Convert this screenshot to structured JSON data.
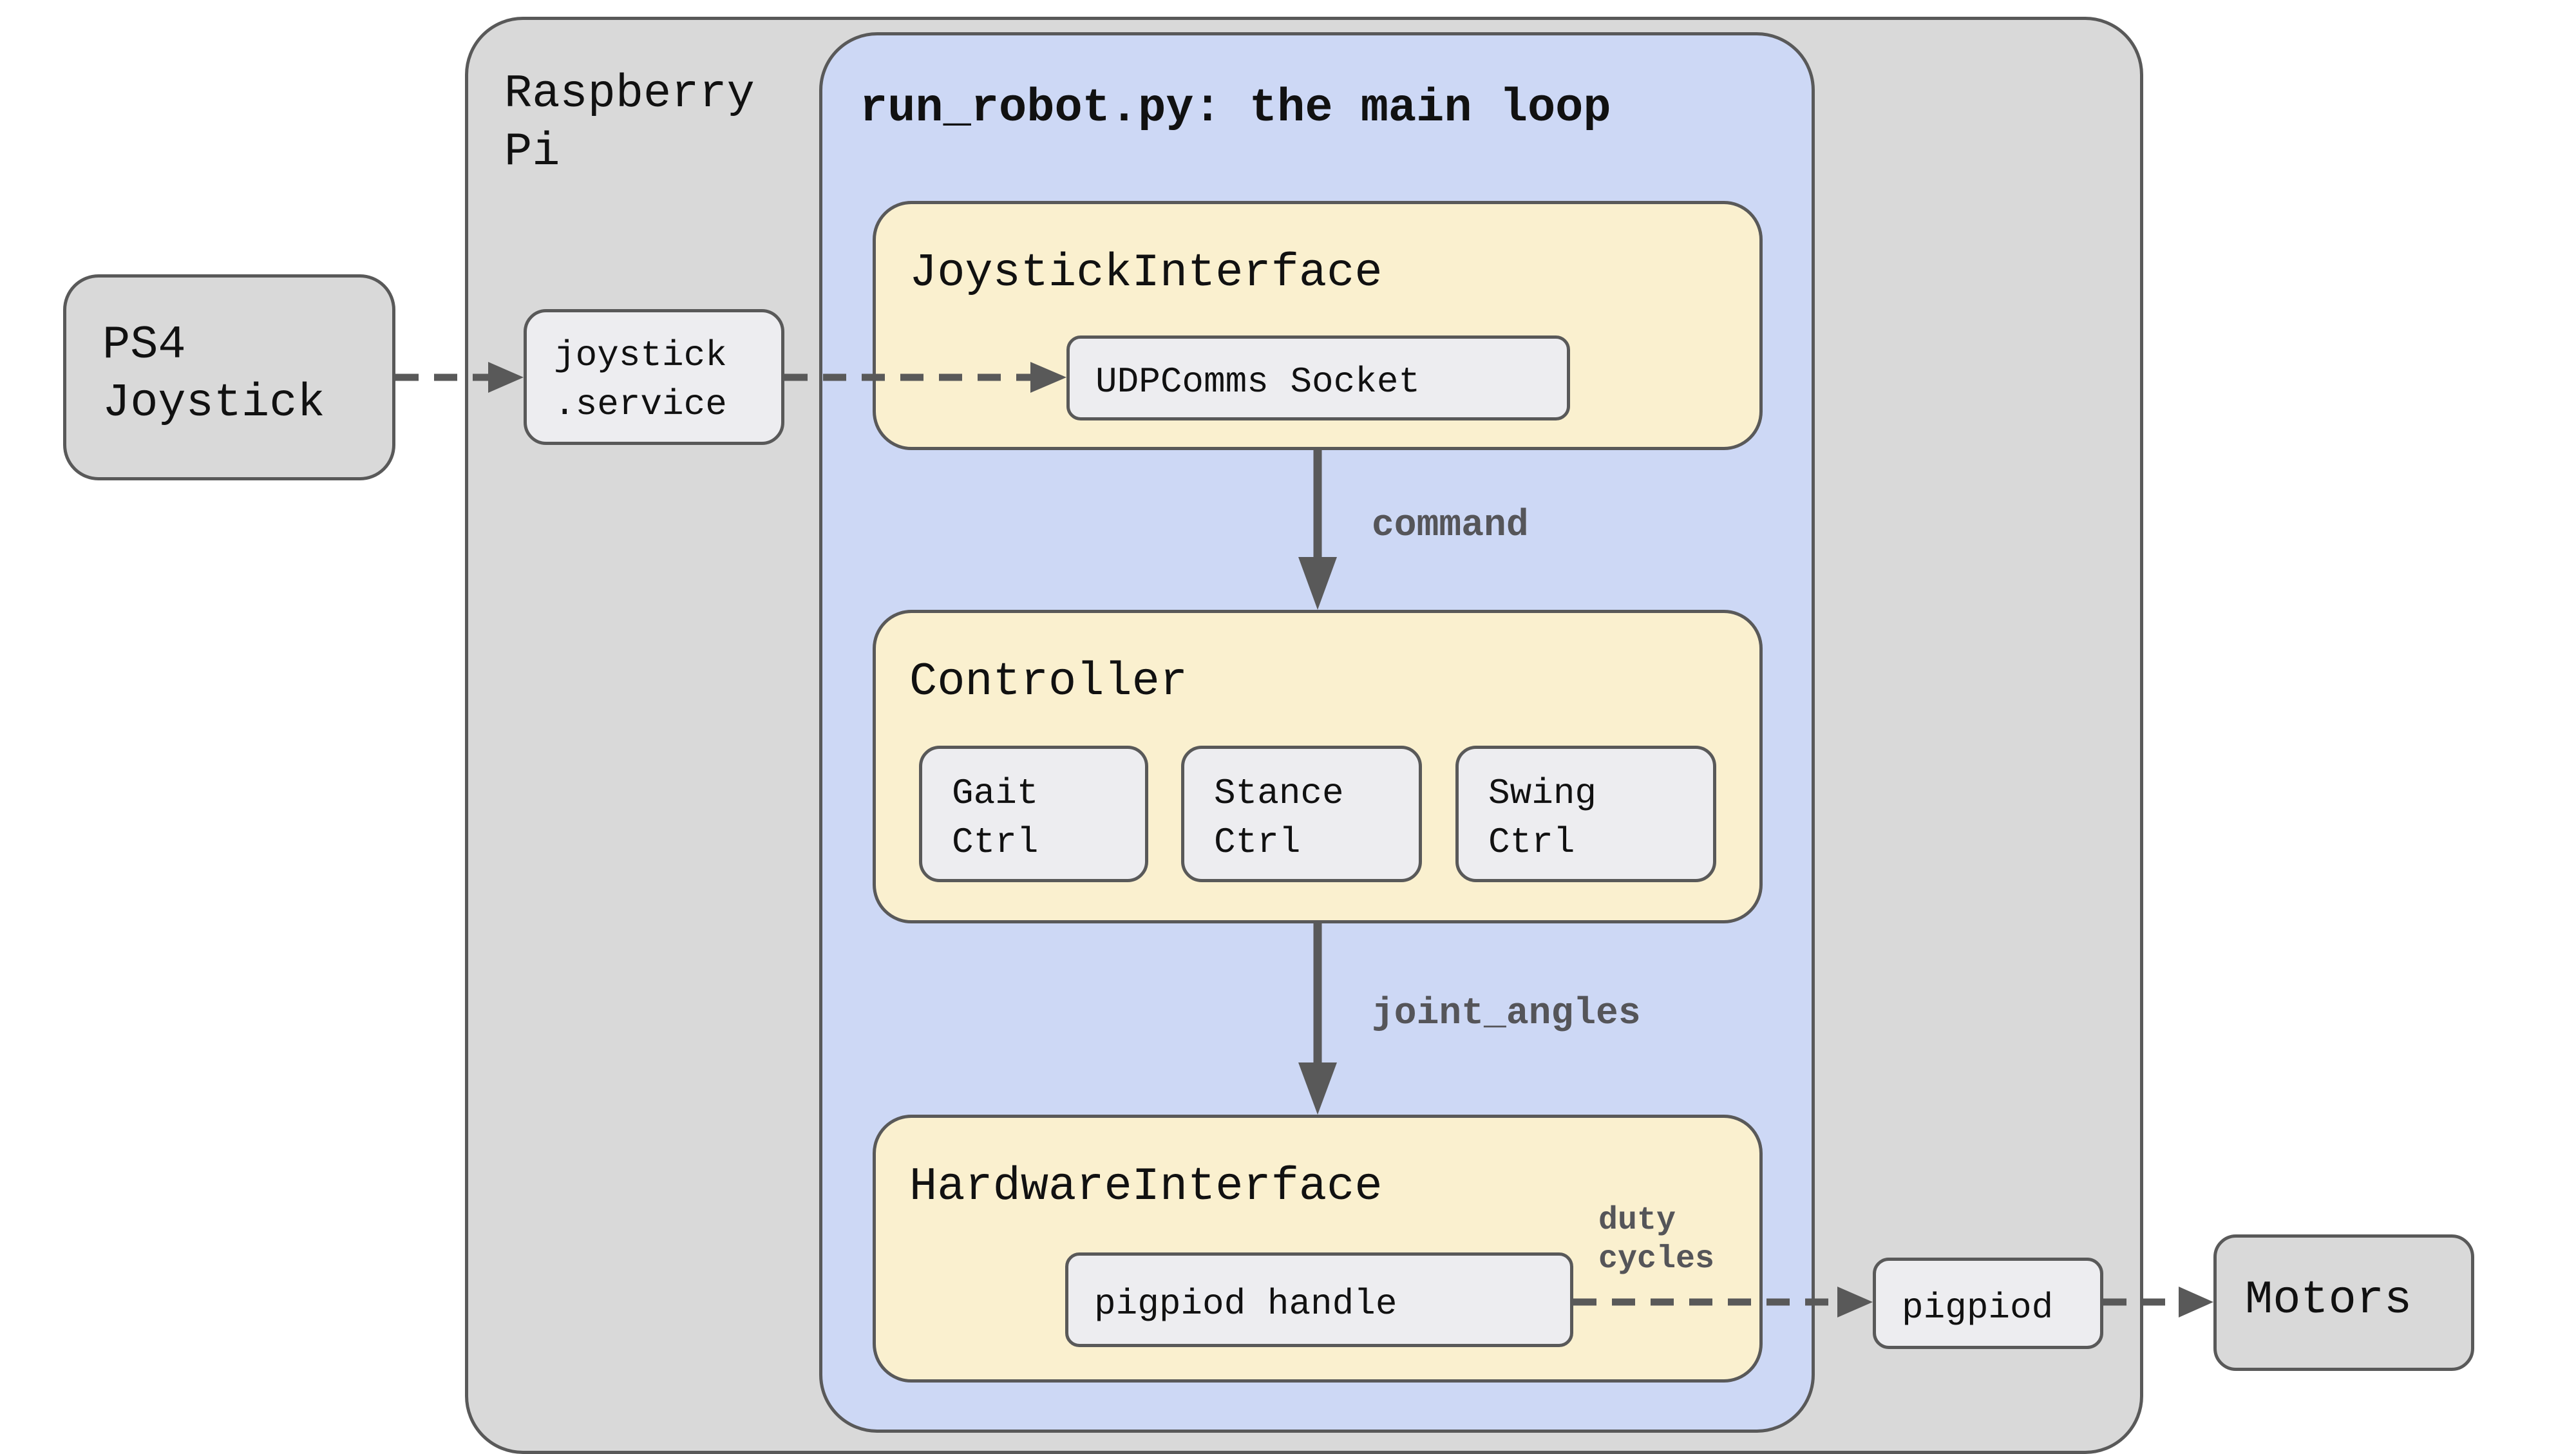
{
  "diagram": {
    "external": {
      "ps4": "PS4\nJoystick",
      "motors": "Motors"
    },
    "raspberry_pi": {
      "title": "Raspberry\nPi",
      "joystick_service": "joystick\n.service",
      "pigpiod": "pigpiod"
    },
    "main_loop": {
      "title": "run_robot.py: the main loop",
      "joystick_interface": {
        "title": "JoystickInterface",
        "socket": "UDPComms Socket"
      },
      "controller": {
        "title": "Controller",
        "subs": [
          "Gait\nCtrl",
          "Stance\nCtrl",
          "Swing\nCtrl"
        ]
      },
      "hardware_interface": {
        "title": "HardwareInterface",
        "handle": "pigpiod handle"
      }
    },
    "edges": {
      "command": "command",
      "joint_angles": "joint_angles",
      "duty_cycles": "duty\ncycles"
    },
    "colors": {
      "outer_gray": "#d9d9d9",
      "main_loop_blue": "#cdd8f5",
      "module_cream": "#faf0cf",
      "leaf_light": "#ededf0",
      "stroke": "#595959"
    }
  }
}
